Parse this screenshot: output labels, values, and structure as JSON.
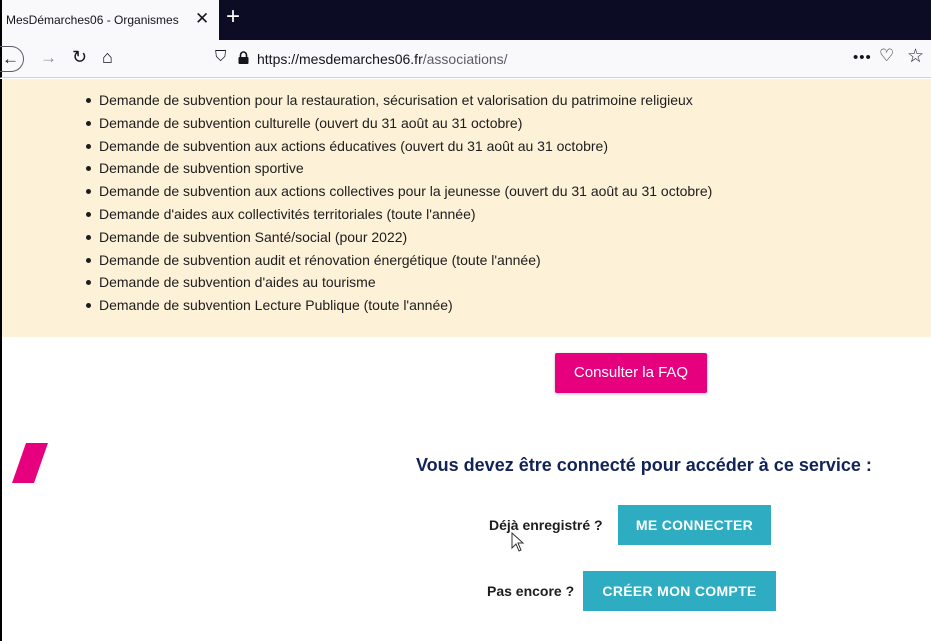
{
  "browser": {
    "tab_title": "MesDémarches06 - Organismes",
    "tab_close_icon": "close-icon",
    "new_tab_label": "+",
    "url_host": "https://mesdemarches06.fr",
    "url_path": "/associations/"
  },
  "notice": {
    "background_color": "#fdf1d8",
    "items": [
      "Demande de subvention pour la restauration, sécurisation et valorisation du patrimoine religieux",
      "Demande de subvention culturelle (ouvert du 31 août au 31 octobre)",
      "Demande de subvention aux actions éducatives (ouvert du 31 août au 31 octobre)",
      "Demande de subvention sportive",
      "Demande de subvention aux actions collectives pour la jeunesse (ouvert du 31 août au 31 octobre)",
      "Demande d'aides aux collectivités territoriales (toute l'année)",
      "Demande de subvention Santé/social (pour 2022)",
      "Demande de subvention audit et rénovation énergétique (toute l'année)",
      "Demande de subvention d'aides au tourisme",
      "Demande de subvention Lecture Publique (toute l'année)"
    ]
  },
  "faq": {
    "label": "Consulter la FAQ",
    "color": "#e6007e"
  },
  "connect": {
    "title": "Vous devez être connecté pour accéder à ce service :",
    "title_color": "#12235a",
    "registered_label": "Déjà enregistré ?",
    "login_button": "ME CONNECTER",
    "not_yet_label": "Pas encore ?",
    "create_button": "CRÉER MON COMPTE",
    "button_color": "#2eacc1"
  }
}
